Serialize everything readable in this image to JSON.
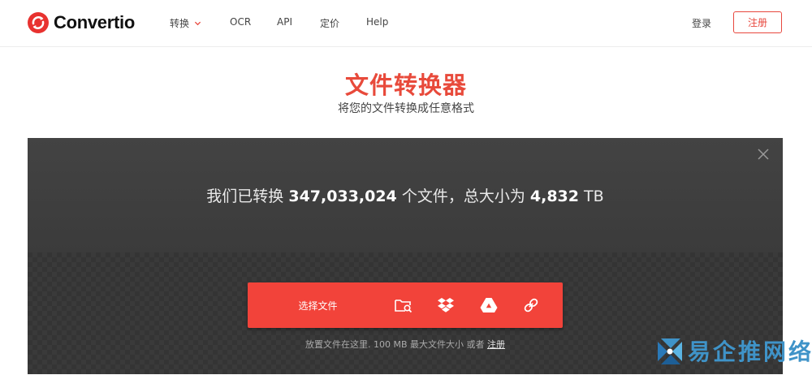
{
  "brand": {
    "name": "Convertio",
    "accent": "#e84a3b"
  },
  "nav": {
    "items": [
      {
        "label": "转换",
        "has_dropdown": true
      },
      {
        "label": "OCR"
      },
      {
        "label": "API"
      },
      {
        "label": "定价"
      },
      {
        "label": "Help"
      }
    ]
  },
  "auth": {
    "login_label": "登录",
    "register_label": "注册"
  },
  "hero": {
    "title": "文件转换器",
    "subtitle": "将您的文件转换成任意格式"
  },
  "stats": {
    "prefix": "我们已转换",
    "files_count": "347,033,024",
    "files_unit": "个文件，总大小为",
    "total_size": "4,832",
    "size_unit": "TB"
  },
  "upload": {
    "choose_label": "选择文件",
    "sources": [
      "folder-search-icon",
      "dropbox-icon",
      "google-drive-icon",
      "url-link-icon"
    ],
    "hint_prefix": "放置文件在这里. 100 MB 最大文件大小 或者",
    "hint_link": "注册"
  },
  "watermark": {
    "text": "易企推网络"
  }
}
